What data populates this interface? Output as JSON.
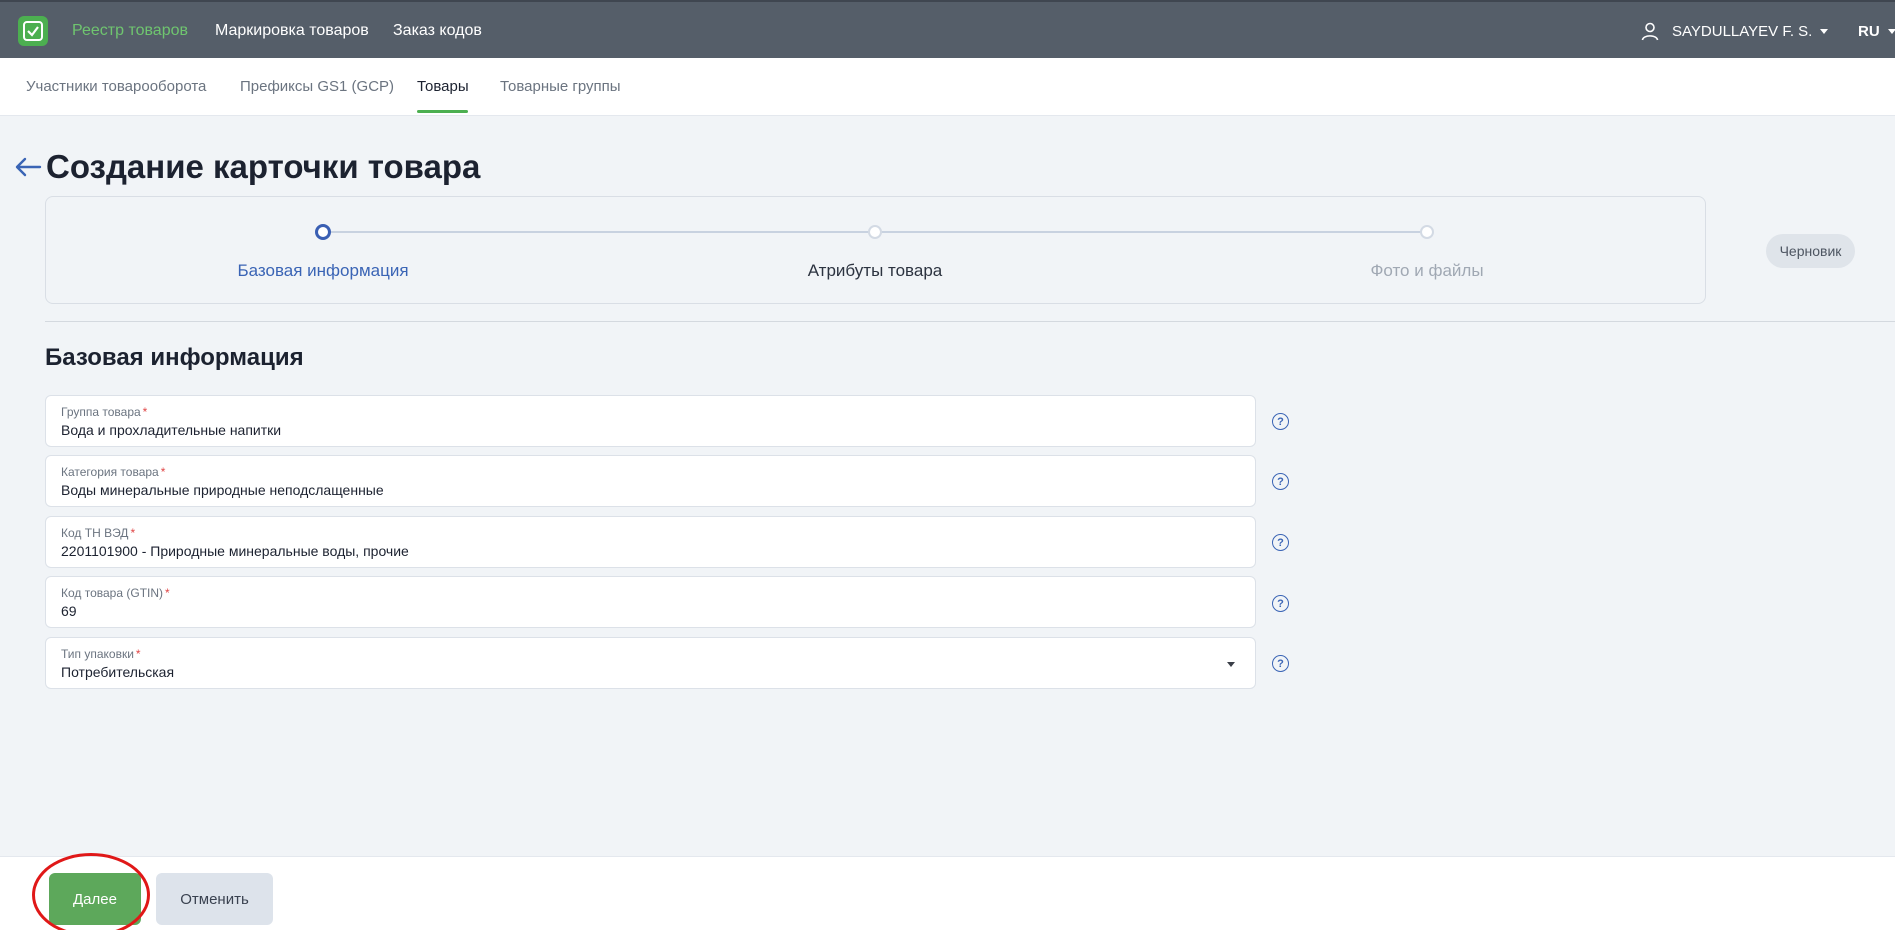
{
  "topbar": {
    "nav": [
      {
        "label": "Реестр товаров",
        "active": true
      },
      {
        "label": "Маркировка товаров",
        "active": false
      },
      {
        "label": "Заказ кодов",
        "active": false
      }
    ],
    "user_name": "SAYDULLAYEV F. S.",
    "language": "RU"
  },
  "subnav": {
    "items": [
      {
        "label": "Участники товарооборота",
        "active": false
      },
      {
        "label": "Префиксы GS1 (GCP)",
        "active": false
      },
      {
        "label": "Товары",
        "active": true
      },
      {
        "label": "Товарные группы",
        "active": false
      }
    ]
  },
  "page": {
    "title": "Создание карточки товара",
    "status_badge": "Черновик"
  },
  "stepper": {
    "current_step": 1,
    "steps": [
      {
        "label": "Базовая информация",
        "state": "active"
      },
      {
        "label": "Атрибуты товара",
        "state": "pending"
      },
      {
        "label": "Фото и файлы",
        "state": "disabled"
      }
    ]
  },
  "form": {
    "section_title": "Базовая информация",
    "required_mark": "*",
    "fields": [
      {
        "label": "Группа товара",
        "value": "Вода и прохладительные напитки",
        "type": "text"
      },
      {
        "label": "Категория товара",
        "value": "Воды минеральные природные неподслащенные",
        "type": "text"
      },
      {
        "label": "Код ТН ВЭД",
        "value": "2201101900 - Природные минеральные воды, прочие",
        "type": "text"
      },
      {
        "label": "Код товара (GTIN)",
        "value": "69",
        "type": "text"
      },
      {
        "label": "Тип упаковки",
        "value": "Потребительская",
        "type": "select"
      }
    ],
    "help_icon": "?"
  },
  "footer": {
    "next_label": "Далее",
    "cancel_label": "Отменить"
  },
  "colors": {
    "topbar": "#555e69",
    "accent_green": "#5da85b",
    "accent_blue": "#3a64b5",
    "highlight_red": "#e01818"
  }
}
